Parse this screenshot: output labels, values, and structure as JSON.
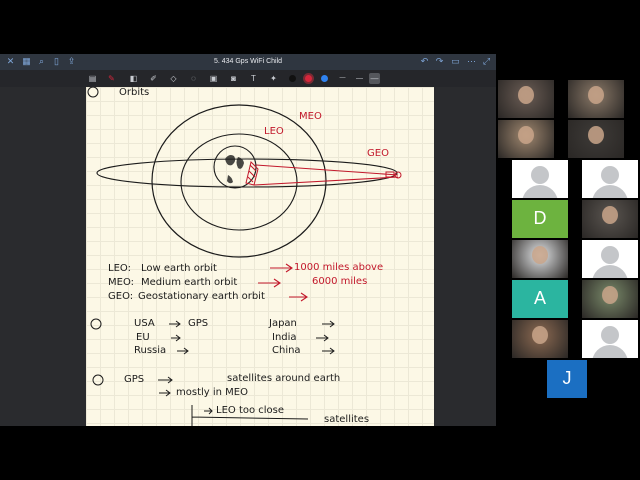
{
  "window": {
    "title": "5. 434 Gps WiFi Child"
  },
  "toolbar": {
    "colors": {
      "black": "#111111",
      "red": "#d6263b",
      "blue": "#2f82f0"
    }
  },
  "notes": {
    "heading": "Orbits",
    "diagram_labels": {
      "leo": "LEO",
      "meo": "MEO",
      "geo": "GEO"
    },
    "definitions": [
      {
        "abbr": "LEO:",
        "text": "Low earth orbit",
        "distance": "1000 miles above"
      },
      {
        "abbr": "MEO:",
        "text": "Medium earth orbit",
        "distance": "6000 miles"
      },
      {
        "abbr": "GEO:",
        "text": "Geostationary earth orbit",
        "distance": ""
      }
    ],
    "systems": {
      "left": [
        "USA",
        "EU",
        "Russia"
      ],
      "gps": "GPS",
      "right": [
        "Japan",
        "India",
        "China"
      ]
    },
    "gps_section": {
      "label": "GPS",
      "line1": "satellites around earth",
      "line2": "mostly in MEO",
      "line3": "LEO too close",
      "line4": "satellites"
    }
  },
  "participants": [
    {
      "type": "video",
      "tone": "#6b5d55"
    },
    {
      "type": "video",
      "tone": "#8a7968"
    },
    {
      "type": "video",
      "tone": "#a08870"
    },
    {
      "type": "video",
      "tone": "#3e3b38"
    },
    {
      "type": "placeholder"
    },
    {
      "type": "placeholder"
    },
    {
      "type": "letter",
      "letter": "D",
      "color": "#6db33f"
    },
    {
      "type": "video",
      "tone": "#5a5550"
    },
    {
      "type": "video",
      "tone": "#e2e4e6"
    },
    {
      "type": "placeholder"
    },
    {
      "type": "letter",
      "letter": "A",
      "color": "#2bb5a0"
    },
    {
      "type": "video",
      "tone": "#7a8a6a"
    },
    {
      "type": "video",
      "tone": "#8c6a52"
    },
    {
      "type": "placeholder"
    },
    {
      "type": "letter",
      "letter": "J",
      "color": "#1b6fc2"
    }
  ]
}
